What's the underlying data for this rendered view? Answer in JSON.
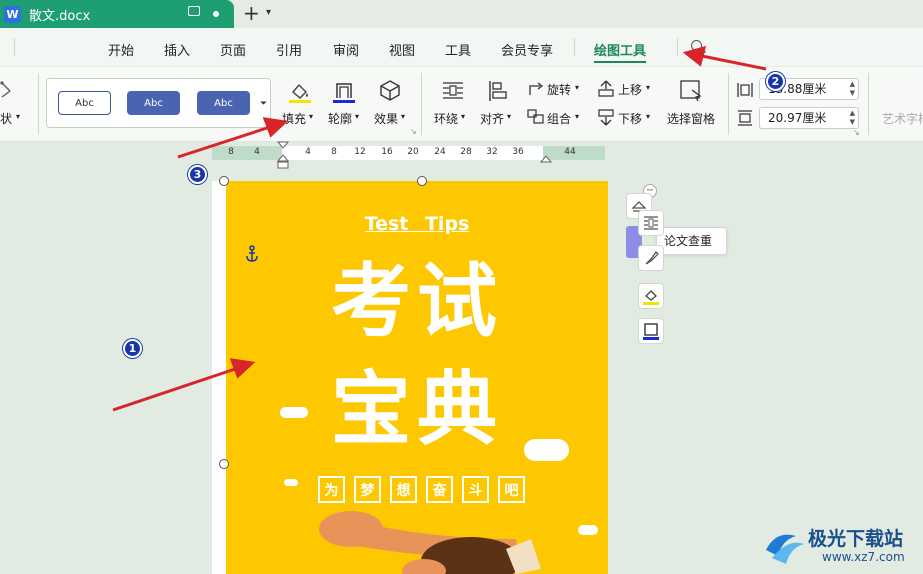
{
  "window": {
    "doc_name": "散文.docx",
    "file_badge": "W"
  },
  "menu": {
    "items": [
      "开始",
      "插入",
      "页面",
      "引用",
      "审阅",
      "视图",
      "工具",
      "会员专享",
      "绘图工具"
    ],
    "active": "绘图工具"
  },
  "ribbon": {
    "shape_label": "状",
    "style_samples": [
      "Abc",
      "Abc",
      "Abc"
    ],
    "fill": "填充",
    "outline": "轮廓",
    "effects": "效果",
    "wrap": "环绕",
    "align": "对齐",
    "rotate": "旋转",
    "group": "组合",
    "bring_forward": "上移",
    "send_backward": "下移",
    "selection_pane": "选择窗格",
    "width_value": "13.88厘米",
    "height_value": "20.97厘米",
    "art_text": "艺术字样"
  },
  "ruler": {
    "ticks": [
      "8",
      "4",
      "4",
      "8",
      "12",
      "16",
      "20",
      "24",
      "28",
      "32",
      "36",
      "44"
    ]
  },
  "poster": {
    "subtitle": "Test Tips",
    "title_line1": "考试",
    "title_line2": "宝典",
    "motto": [
      "为",
      "梦",
      "想",
      "奋",
      "斗",
      "吧"
    ]
  },
  "floating": {
    "tooltip": "论文查重"
  },
  "badges": [
    "1",
    "2",
    "3"
  ],
  "watermark": {
    "name": "极光下载站",
    "url": "www.xz7.com"
  },
  "colors": {
    "accent": "#1e8a5a",
    "poster_bg": "#fdc800",
    "arrow": "#d9242b",
    "badge": "#1836a8"
  }
}
